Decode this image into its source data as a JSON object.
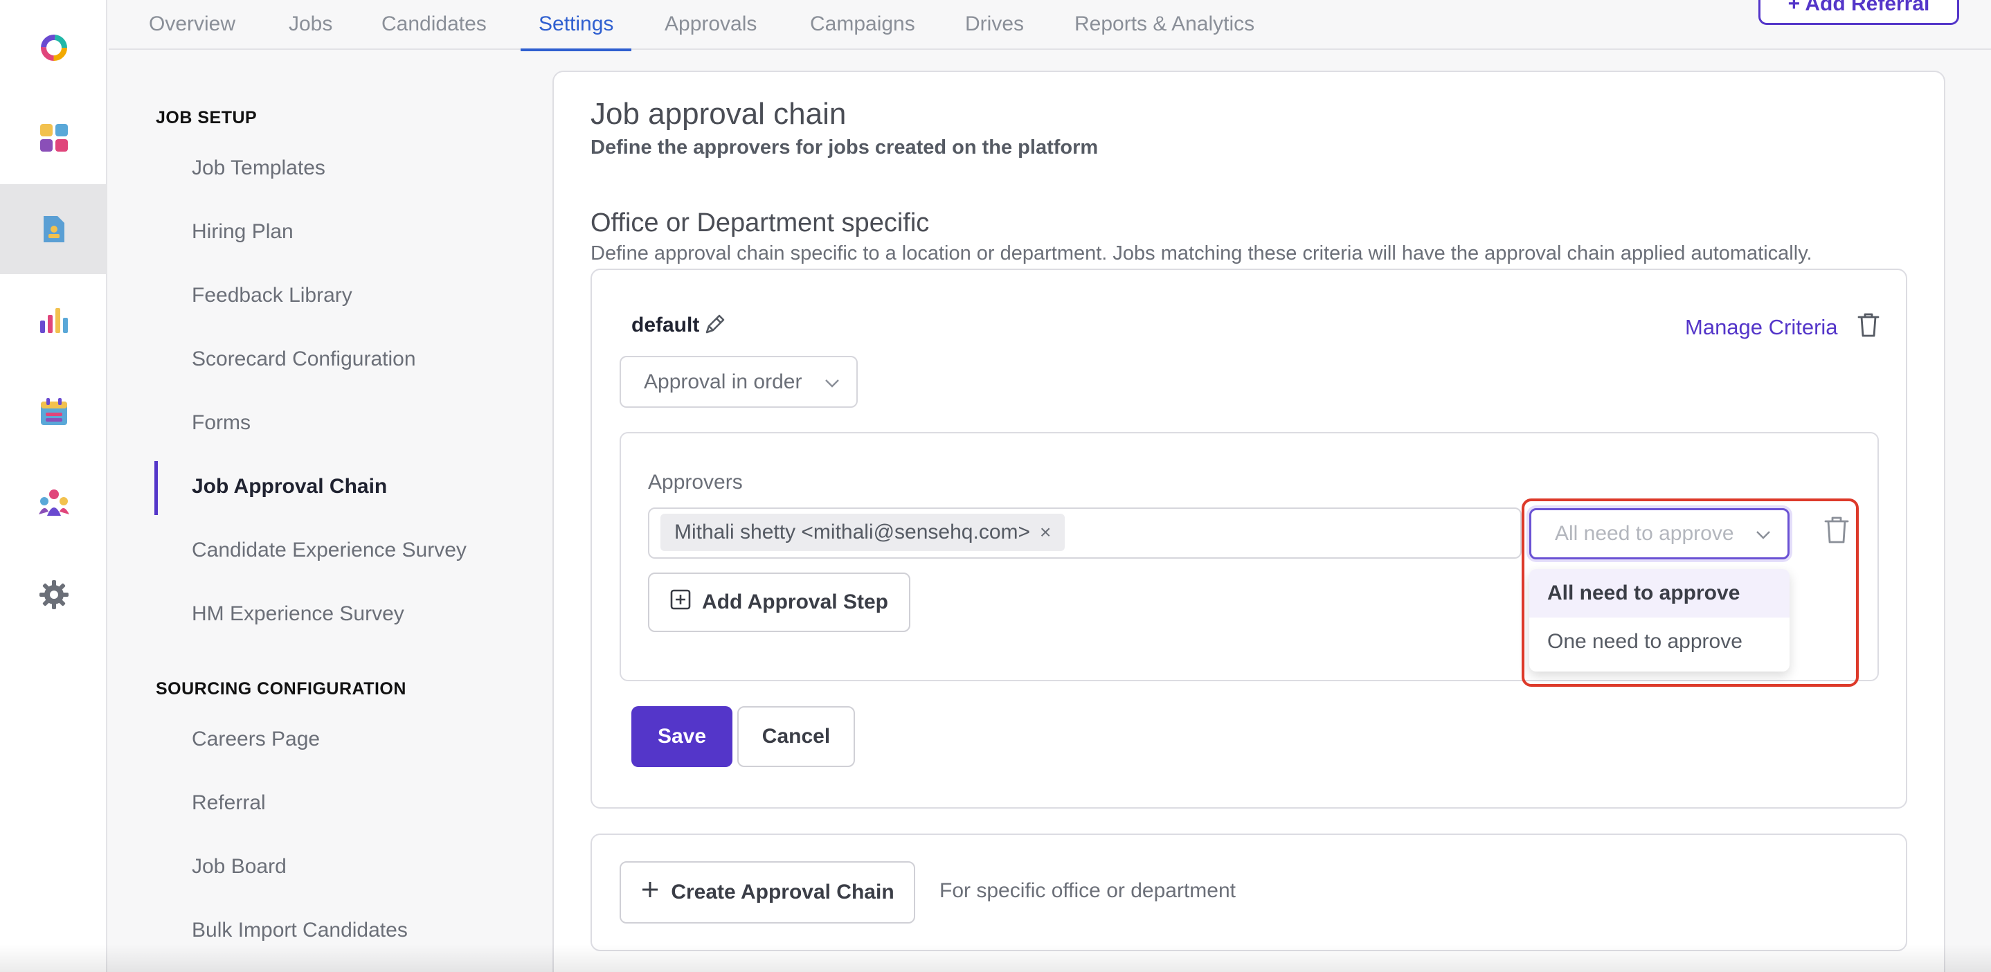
{
  "rail": {
    "icons": [
      "logo-ring-icon",
      "dashboard-grid-icon",
      "jobs-document-icon",
      "analytics-bars-icon",
      "calendar-icon",
      "people-icon",
      "settings-gear-icon"
    ],
    "active": "jobs-document-icon"
  },
  "tabs": [
    {
      "label": "Overview"
    },
    {
      "label": "Jobs"
    },
    {
      "label": "Candidates"
    },
    {
      "label": "Settings",
      "active": true
    },
    {
      "label": "Approvals"
    },
    {
      "label": "Campaigns"
    },
    {
      "label": "Drives"
    },
    {
      "label": "Reports & Analytics"
    }
  ],
  "header": {
    "referral_button": "+ Add Referral"
  },
  "sidebar": {
    "job_setup_heading": "JOB SETUP",
    "job_setup_items": [
      "Job Templates",
      "Hiring Plan",
      "Feedback Library",
      "Scorecard Configuration",
      "Forms",
      "Job Approval Chain",
      "Candidate Experience Survey",
      "HM Experience Survey"
    ],
    "active_item": "Job Approval Chain",
    "sourcing_heading": "SOURCING CONFIGURATION",
    "sourcing_items": [
      "Careers Page",
      "Referral",
      "Job Board",
      "Bulk Import Candidates"
    ]
  },
  "main": {
    "title": "Job approval chain",
    "subtitle": "Define the approvers for jobs created on the platform",
    "section_title": "Office or Department specific",
    "section_subtitle": "Define approval chain specific to a location or department. Jobs matching these criteria will have the approval chain applied automatically.",
    "chain": {
      "name": "default",
      "manage_criteria": "Manage Criteria",
      "order_select": "Approval in order",
      "approvers_label": "Approvers",
      "approver_chip": "Mithali shetty <mithali@sensehq.com>",
      "approval_type_placeholder": "All need to approve",
      "approval_type_options": [
        "All need to approve",
        "One need to approve"
      ],
      "highlighted_option": "All need to approve",
      "add_step": "Add Approval Step",
      "save": "Save",
      "cancel": "Cancel"
    },
    "create": {
      "button": "Create Approval Chain",
      "note": "For specific office or department"
    }
  },
  "colors": {
    "accent": "#5436c9",
    "tab_active": "#2f5fd0",
    "highlight_border": "#dd3a2a"
  }
}
